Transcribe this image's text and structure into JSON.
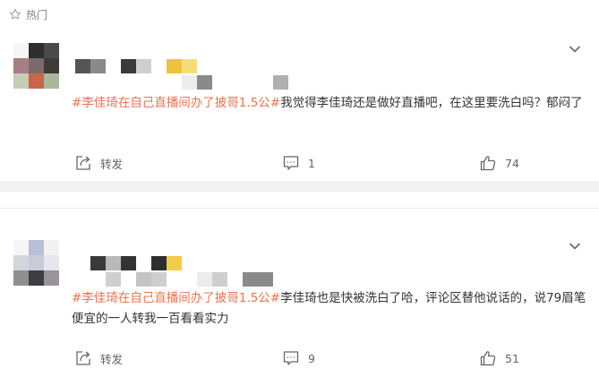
{
  "section": {
    "title": "热门",
    "icon": "star-outline-icon"
  },
  "posts": [
    {
      "topic": "#李佳琦在自己直播间办了披哥1.5公#",
      "body": "我觉得李佳琦还是做好直播吧，在这里要洗白吗？郁闷了",
      "repost_label": "转发",
      "comment_count": "1",
      "like_count": "74",
      "avatar_colors": [
        "#f6f6f6",
        "#2e2e2e",
        "#4a4a4a",
        "#a67e84",
        "#7d6b6b",
        "#3f3a38",
        "#c6cdb4",
        "#c9654a",
        "#a8b89a"
      ],
      "name_colors": [
        "#555555",
        "#8a8a8a",
        "#ffffff",
        "#3a3a3a",
        "#cfcfcf",
        "#ffffff",
        "#f0c23a",
        "#f6dd7a"
      ],
      "meta_colors": [
        "#ffffff",
        "#ffffff",
        "#ffffff",
        "#ffffff",
        "#ffffff",
        "#ffffff",
        "#ffffff",
        "#ececec",
        "#8a8a8a",
        "#ffffff",
        "#ffffff",
        "#ffffff",
        "#ffffff",
        "#b0b0b0"
      ]
    },
    {
      "topic": "#李佳琦在自己直播间办了披哥1.5公#",
      "body": "李佳琦也是快被洗白了哈，评论区替他说话的，说79眉笔便宜的一人转我一百看看实力",
      "repost_label": "转发",
      "comment_count": "9",
      "like_count": "51",
      "avatar_colors": [
        "#f6f6f6",
        "#b7bfd8",
        "#f1f1f1",
        "#d4d6dc",
        "#c7ccd6",
        "#e6e7ea",
        "#8f8f92",
        "#3e3e40",
        "#98949a"
      ],
      "name_colors": [
        "#ffffff",
        "#3a3a3a",
        "#b9b9b9",
        "#333333",
        "#ffffff",
        "#2e2e2e",
        "#f2cc48"
      ],
      "meta_colors": [
        "#ffffff",
        "#ffffff",
        "#cfcfcf",
        "#ffffff",
        "#c4c4c4",
        "#cfcfcf",
        "#ffffff",
        "#ffffff",
        "#ececec",
        "#cfcfcf",
        "#ffffff",
        "#8a8a8a",
        "#8a8a8a"
      ]
    }
  ],
  "colors": {
    "topic": "#eb7350",
    "text": "#333333",
    "action": "#636363",
    "separator": "#f2f2f2"
  }
}
